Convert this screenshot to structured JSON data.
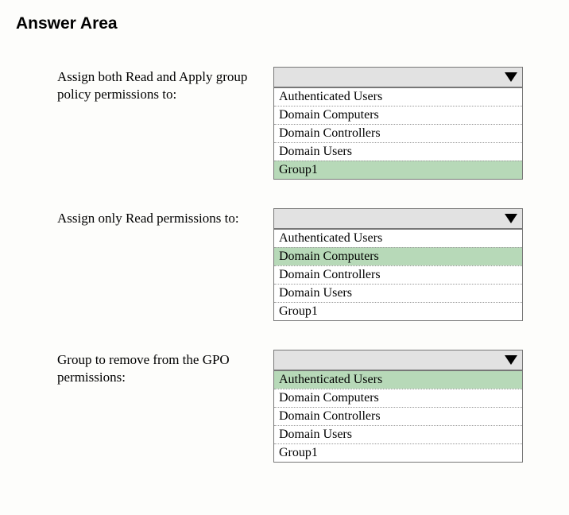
{
  "heading": "Answer Area",
  "questions": [
    {
      "label": "Assign both Read and Apply group policy permissions to:",
      "options": [
        "Authenticated Users",
        "Domain Computers",
        "Domain Controllers",
        "Domain Users",
        "Group1"
      ],
      "highlight_index": 4
    },
    {
      "label": "Assign only Read permissions to:",
      "options": [
        "Authenticated Users",
        "Domain Computers",
        "Domain Controllers",
        "Domain Users",
        "Group1"
      ],
      "highlight_index": 1
    },
    {
      "label": "Group to remove from the GPO permissions:",
      "options": [
        "Authenticated Users",
        "Domain Computers",
        "Domain Controllers",
        "Domain Users",
        "Group1"
      ],
      "highlight_index": 0
    }
  ]
}
